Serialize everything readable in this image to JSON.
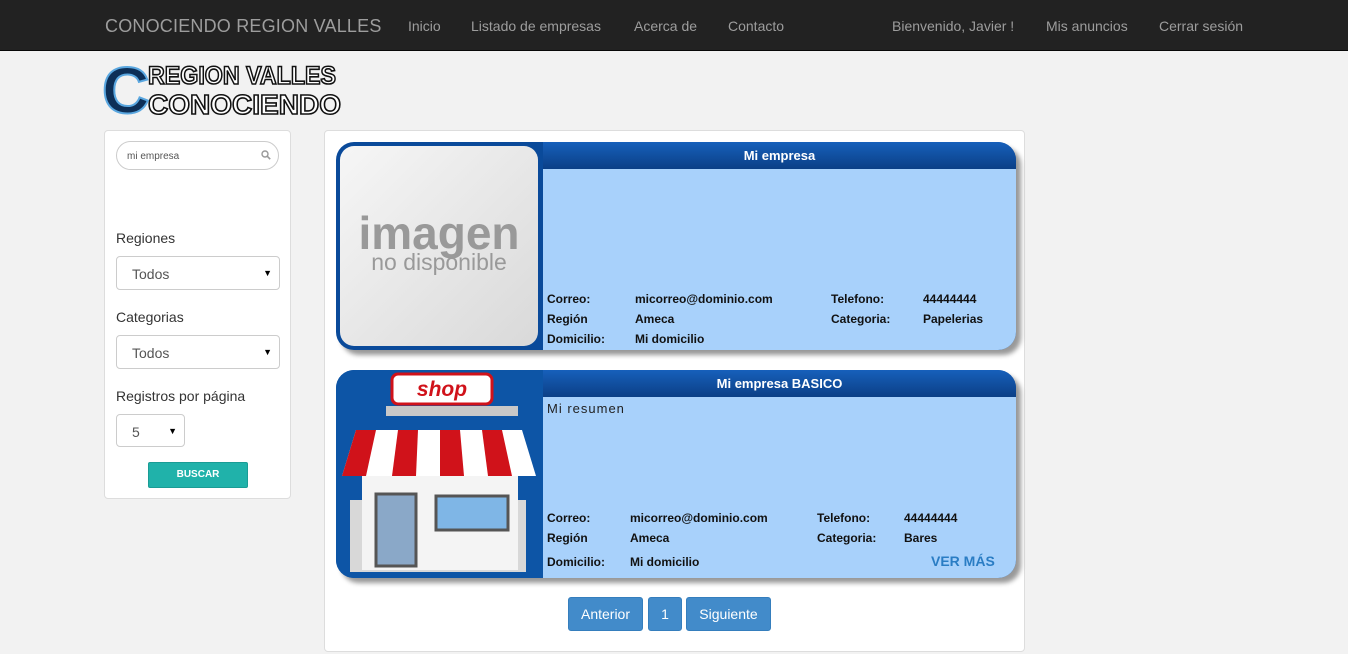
{
  "navbar": {
    "brand": "CONOCIENDO REGION VALLES",
    "links": [
      "Inicio",
      "Listado de empresas",
      "Acerca de",
      "Contacto"
    ],
    "user": "Bienvenido, Javier !",
    "my_ads": "Mis anuncios",
    "logout": "Cerrar sesión"
  },
  "logo": {
    "line1": "REGION VALLES",
    "line2": "CONOCIENDO"
  },
  "sidebar": {
    "search_value": "mi empresa",
    "regiones_label": "Regiones",
    "regiones_value": "Todos",
    "categorias_label": "Categorias",
    "categorias_value": "Todos",
    "registros_label": "Registros por página",
    "registros_value": "5",
    "buscar": "BUSCAR"
  },
  "cards": [
    {
      "title": "Mi empresa",
      "summary": "",
      "image_text": [
        "imagen",
        "no disponible"
      ],
      "correo_label": "Correo:",
      "correo": "micorreo@dominio.com",
      "region_label": "Región",
      "region": "Ameca",
      "domicilio_label": "Domicilio:",
      "domicilio": "Mi domicilio",
      "telefono_label": "Telefono:",
      "telefono": "44444444",
      "categoria_label": "Categoria:",
      "categoria": "Papelerias"
    },
    {
      "title": "Mi empresa BASICO",
      "summary": "Mi resumen",
      "image_text": [
        "shop"
      ],
      "correo_label": "Correo:",
      "correo": "micorreo@dominio.com",
      "region_label": "Región",
      "region": "Ameca",
      "domicilio_label": "Domicilio:",
      "domicilio": "Mi domicilio",
      "telefono_label": "Telefono:",
      "telefono": "44444444",
      "categoria_label": "Categoria:",
      "categoria": "Bares",
      "ver_mas": "VER MÁS"
    }
  ],
  "pagination": {
    "prev": "Anterior",
    "page": "1",
    "next": "Siguiente"
  },
  "colors": {
    "navbar": "#222222",
    "card_title": "#0b4a9a",
    "card_body": "#a8d1fb",
    "accent_button": "#20b2aa",
    "pagination": "#428bca"
  }
}
